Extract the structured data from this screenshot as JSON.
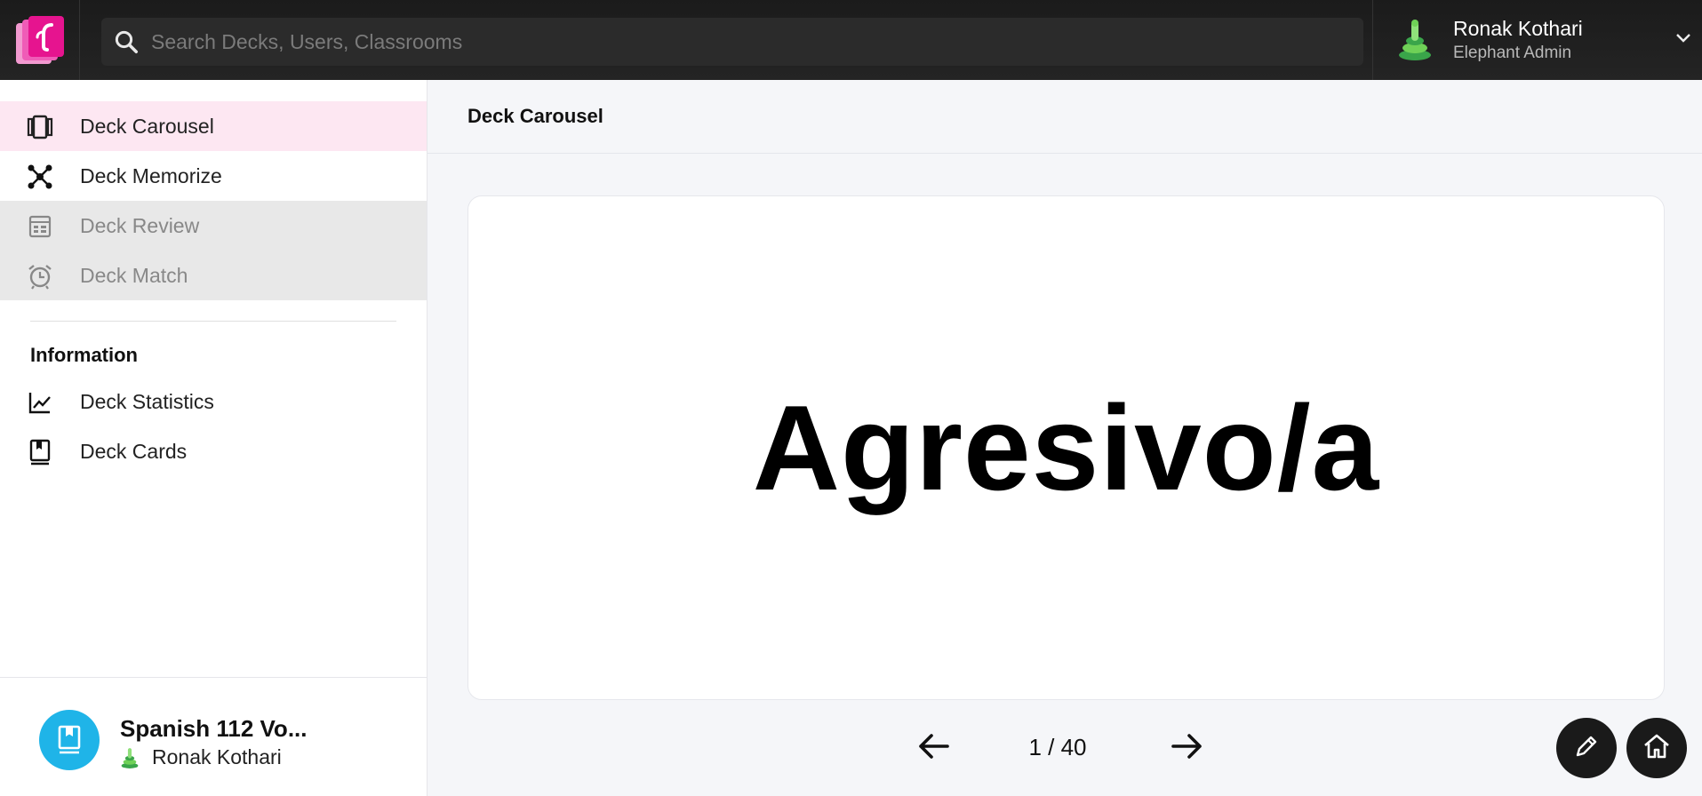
{
  "search": {
    "placeholder": "Search Decks, Users, Classrooms"
  },
  "user": {
    "name": "Ronak Kothari",
    "role": "Elephant Admin"
  },
  "sidebar": {
    "study_items": [
      {
        "label": "Deck Carousel",
        "icon": "carousel-icon",
        "state": "active"
      },
      {
        "label": "Deck Memorize",
        "icon": "network-icon",
        "state": "normal"
      },
      {
        "label": "Deck Review",
        "icon": "calendar-icon",
        "state": "disabled"
      },
      {
        "label": "Deck Match",
        "icon": "alarm-clock-icon",
        "state": "disabled"
      }
    ],
    "info_title": "Information",
    "info_items": [
      {
        "label": "Deck Statistics",
        "icon": "line-chart-icon"
      },
      {
        "label": "Deck Cards",
        "icon": "bookmark-book-icon"
      }
    ]
  },
  "deck": {
    "name": "Spanish 112 Vo...",
    "owner": "Ronak Kothari"
  },
  "main": {
    "title": "Deck Carousel",
    "card_text": "Agresivo/a",
    "page_display": "1 / 40",
    "current_page": 1,
    "total_pages": 40
  },
  "colors": {
    "topbar": "#1f1f1f",
    "brand_pink": "#e6148f",
    "active_bg": "#fde7f2",
    "deck_icon_bg": "#1fb4e8"
  }
}
